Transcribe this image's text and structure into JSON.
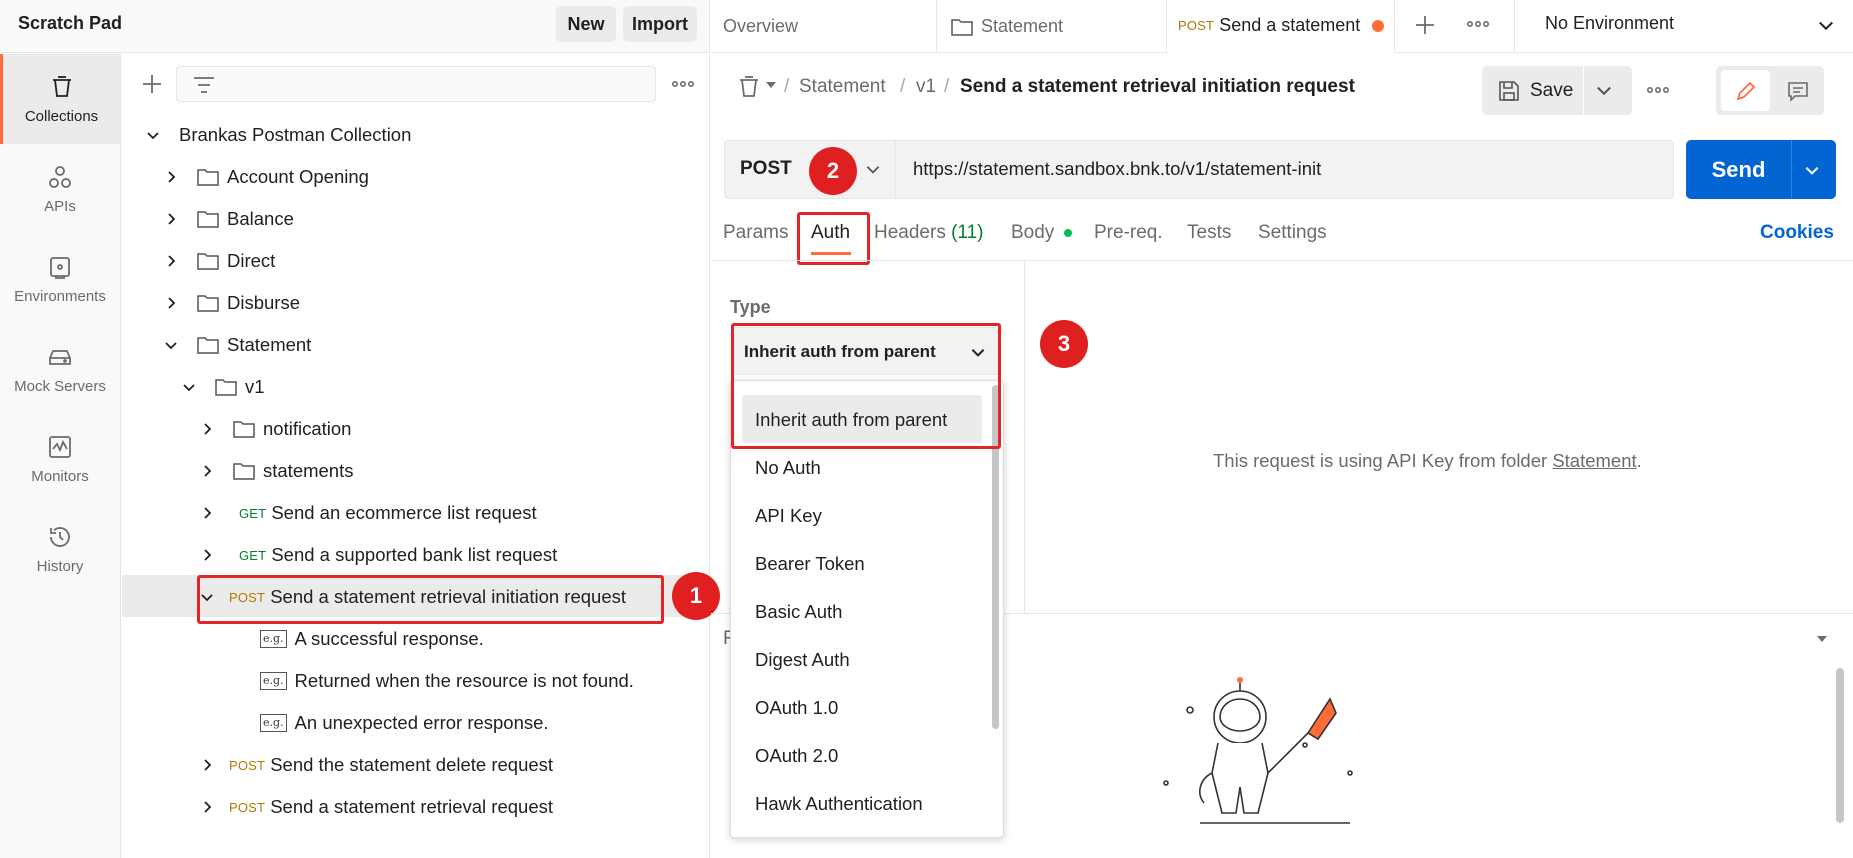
{
  "workspace": {
    "title": "Scratch Pad",
    "new_label": "New",
    "import_label": "Import"
  },
  "leftnav": [
    {
      "label": "Collections",
      "icon": "trash-can-icon"
    },
    {
      "label": "APIs",
      "icon": "apis-icon"
    },
    {
      "label": "Environments",
      "icon": "environments-icon"
    },
    {
      "label": "Mock Servers",
      "icon": "server-icon"
    },
    {
      "label": "Monitors",
      "icon": "monitor-icon"
    },
    {
      "label": "History",
      "icon": "history-icon"
    }
  ],
  "tree": {
    "collection": "Brankas Postman Collection",
    "folders": [
      "Account Opening",
      "Balance",
      "Direct",
      "Disburse",
      "Statement"
    ],
    "v1": "v1",
    "subfolders": [
      "notification",
      "statements"
    ],
    "requests": [
      {
        "method": "GET",
        "name": "Send an ecommerce list request"
      },
      {
        "method": "GET",
        "name": "Send a supported bank list request"
      },
      {
        "method": "POST",
        "name": "Send a statement retrieval initiation request"
      }
    ],
    "examples": [
      "A successful response.",
      "Returned when the resource is not found.",
      "An unexpected error response."
    ],
    "examples_tag": "e.g.",
    "more_requests": [
      {
        "method": "POST",
        "name": "Send the statement delete request"
      },
      {
        "method": "POST",
        "name": "Send a statement retrieval request"
      }
    ]
  },
  "annotations": [
    "1",
    "2",
    "3"
  ],
  "tabs": {
    "overview": "Overview",
    "statement": "Statement",
    "active_method": "POST",
    "active_name": "Send a statement",
    "environment": "No Environment"
  },
  "breadcrumb": {
    "parts": [
      "Statement",
      "v1"
    ],
    "separator": "/",
    "current": "Send a statement retrieval initiation request"
  },
  "save_label": "Save",
  "request": {
    "method": "POST",
    "url": "https://statement.sandbox.bnk.to/v1/statement-init",
    "send_label": "Send"
  },
  "request_tabs": {
    "params": "Params",
    "auth": "Auth",
    "headers": "Headers",
    "headers_count": "(11)",
    "body": "Body",
    "prereq": "Pre-req.",
    "tests": "Tests",
    "settings": "Settings",
    "cookies": "Cookies"
  },
  "auth": {
    "type_label": "Type",
    "selected": "Inherit auth from parent",
    "options": [
      "Inherit auth from parent",
      "No Auth",
      "API Key",
      "Bearer Token",
      "Basic Auth",
      "Digest Auth",
      "OAuth 1.0",
      "OAuth 2.0",
      "Hawk Authentication"
    ],
    "info_prefix": "This request is using API Key from folder ",
    "info_link": "Statement",
    "info_suffix": "."
  },
  "response_label_partial": "R",
  "colors": {
    "accent": "#ff6c37",
    "send_blue": "#0265d2",
    "annotation_red": "#e3252a",
    "post": "#ad7a03",
    "get": "#007f31"
  }
}
